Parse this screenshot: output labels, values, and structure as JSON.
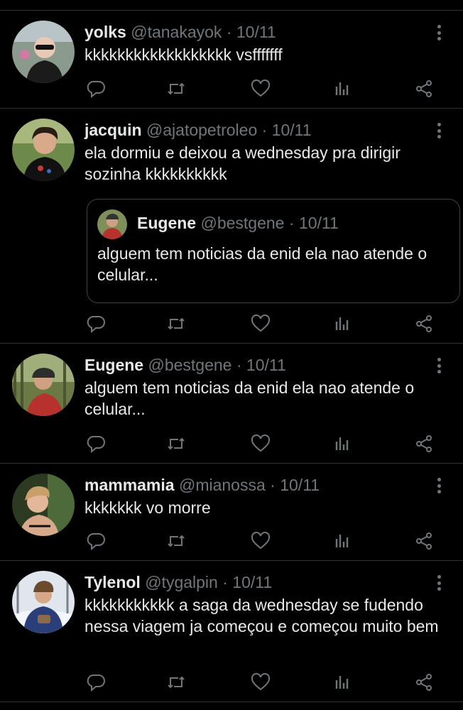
{
  "colors": {
    "background": "#000000",
    "text": "#e7e9ea",
    "muted": "#71767b",
    "divider": "#2f3336"
  },
  "icons": {
    "more": "more-vertical-icon",
    "reply": "reply-icon",
    "retweet": "retweet-icon",
    "like": "heart-icon",
    "views": "views-chart-icon",
    "share": "share-icon"
  },
  "tweets": [
    {
      "name": "yolks",
      "handle": "@tanakayok",
      "sep": "·",
      "date": "10/11",
      "text": "kkkkkkkkkkkkkkkkkk vsfffffff"
    },
    {
      "name": "jacquin",
      "handle": "@ajatopetroleo",
      "sep": "·",
      "date": "10/11",
      "text": "ela dormiu e deixou a wednesday pra dirigir sozinha kkkkkkkkkk",
      "quote": {
        "name": "Eugene",
        "handle": "@bestgene",
        "sep": "·",
        "date": "10/11",
        "text": "alguem tem noticias da enid ela nao atende o celular..."
      }
    },
    {
      "name": "Eugene",
      "handle": "@bestgene",
      "sep": "·",
      "date": "10/11",
      "text": "alguem tem noticias da enid ela nao atende o celular..."
    },
    {
      "name": "mammamia",
      "handle": "@mianossa",
      "sep": "·",
      "date": "10/11",
      "text": "kkkkkkk vo morre"
    },
    {
      "name": "Tylenol",
      "handle": "@tygalpin",
      "sep": "·",
      "date": "10/11",
      "text": "kkkkkkkkkkk a saga da wednesday se fudendo nessa viagem ja começou e começou muito bem"
    }
  ]
}
